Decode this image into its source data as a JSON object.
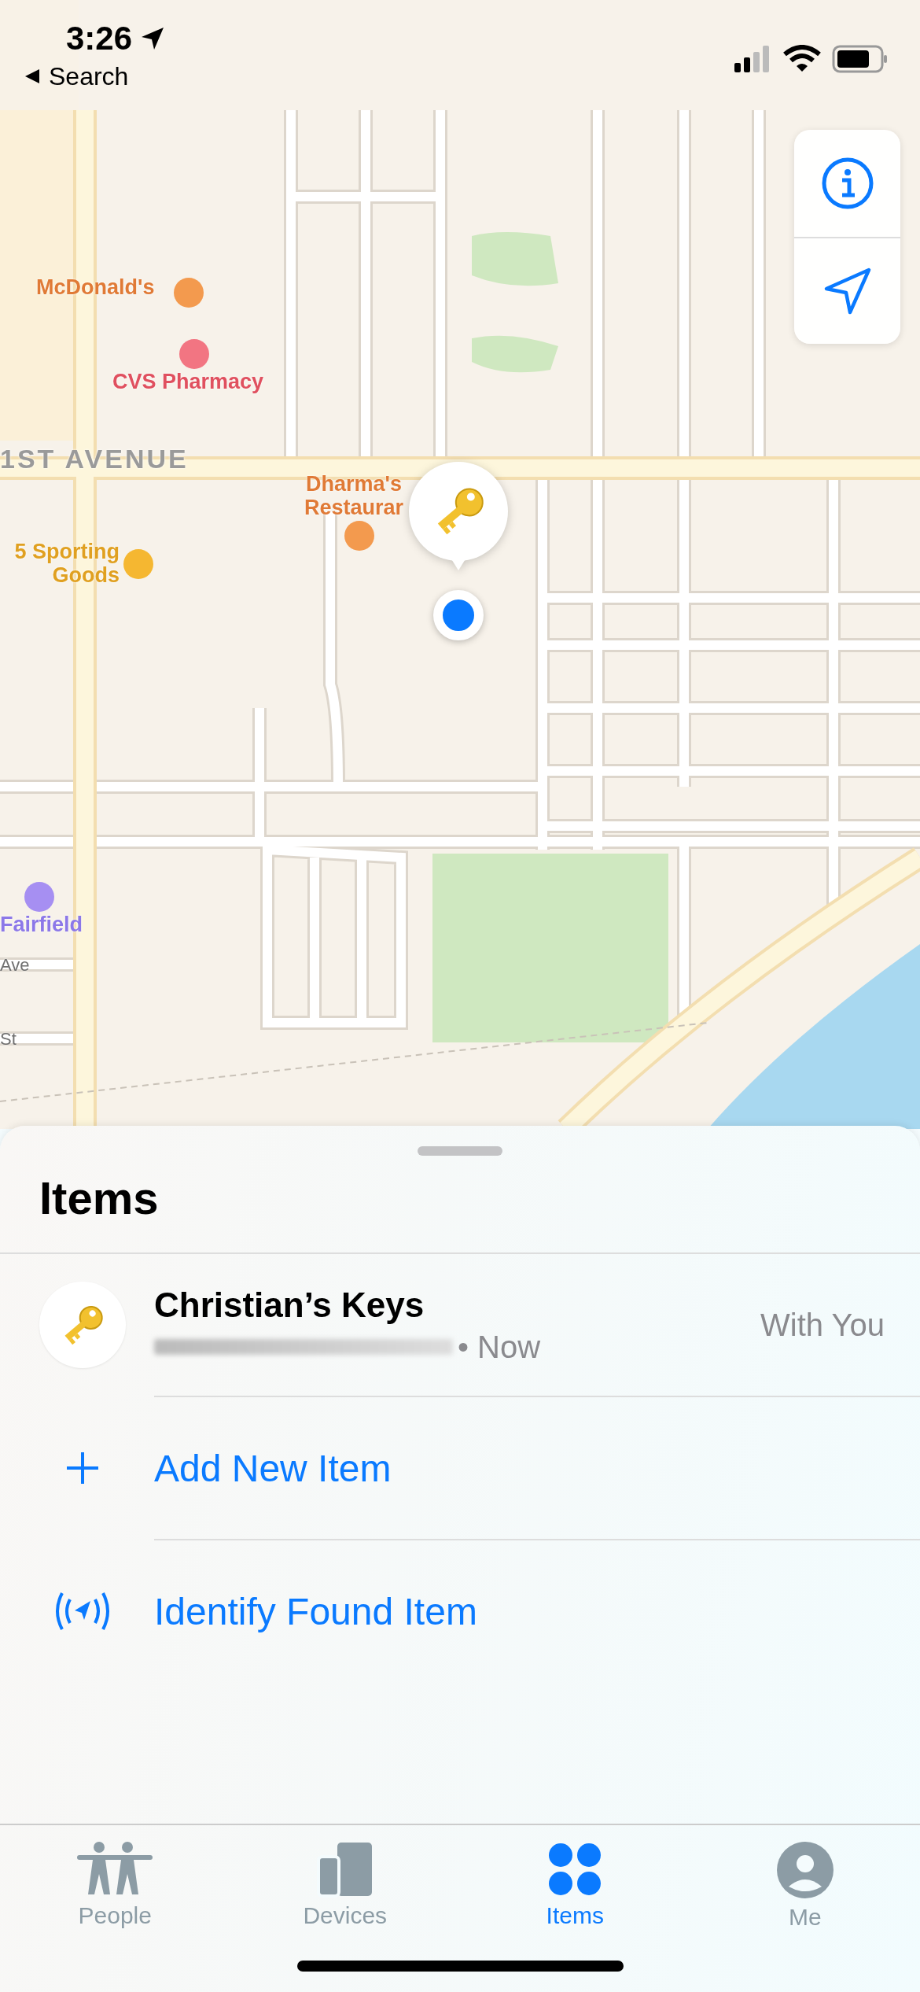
{
  "status_bar": {
    "time": "3:26",
    "back_label": "Search"
  },
  "map": {
    "labels": [
      {
        "text": "McDonald's",
        "kind": "food"
      },
      {
        "text": "CVS Pharmacy",
        "kind": "pharmacy"
      },
      {
        "text": "1ST AVENUE",
        "kind": "street"
      },
      {
        "text": "Dharma's Restaurar",
        "kind": "restaurant"
      },
      {
        "text": "5 Sporting Goods",
        "kind": "shop"
      },
      {
        "text": "Fairfield",
        "kind": "hotel"
      },
      {
        "text": "Ave",
        "kind": "street_small"
      },
      {
        "text": "St",
        "kind": "street_small"
      }
    ]
  },
  "sheet": {
    "title": "Items",
    "items": [
      {
        "name": "Christian’s Keys",
        "time": "• Now",
        "status": "With You"
      }
    ],
    "actions": [
      {
        "label": "Add New Item",
        "kind": "add"
      },
      {
        "label": "Identify Found Item",
        "kind": "identify"
      }
    ]
  },
  "tabs": [
    {
      "label": "People",
      "kind": "people",
      "selected": false
    },
    {
      "label": "Devices",
      "kind": "devices",
      "selected": false
    },
    {
      "label": "Items",
      "kind": "items",
      "selected": true
    },
    {
      "label": "Me",
      "kind": "me",
      "selected": false
    }
  ]
}
